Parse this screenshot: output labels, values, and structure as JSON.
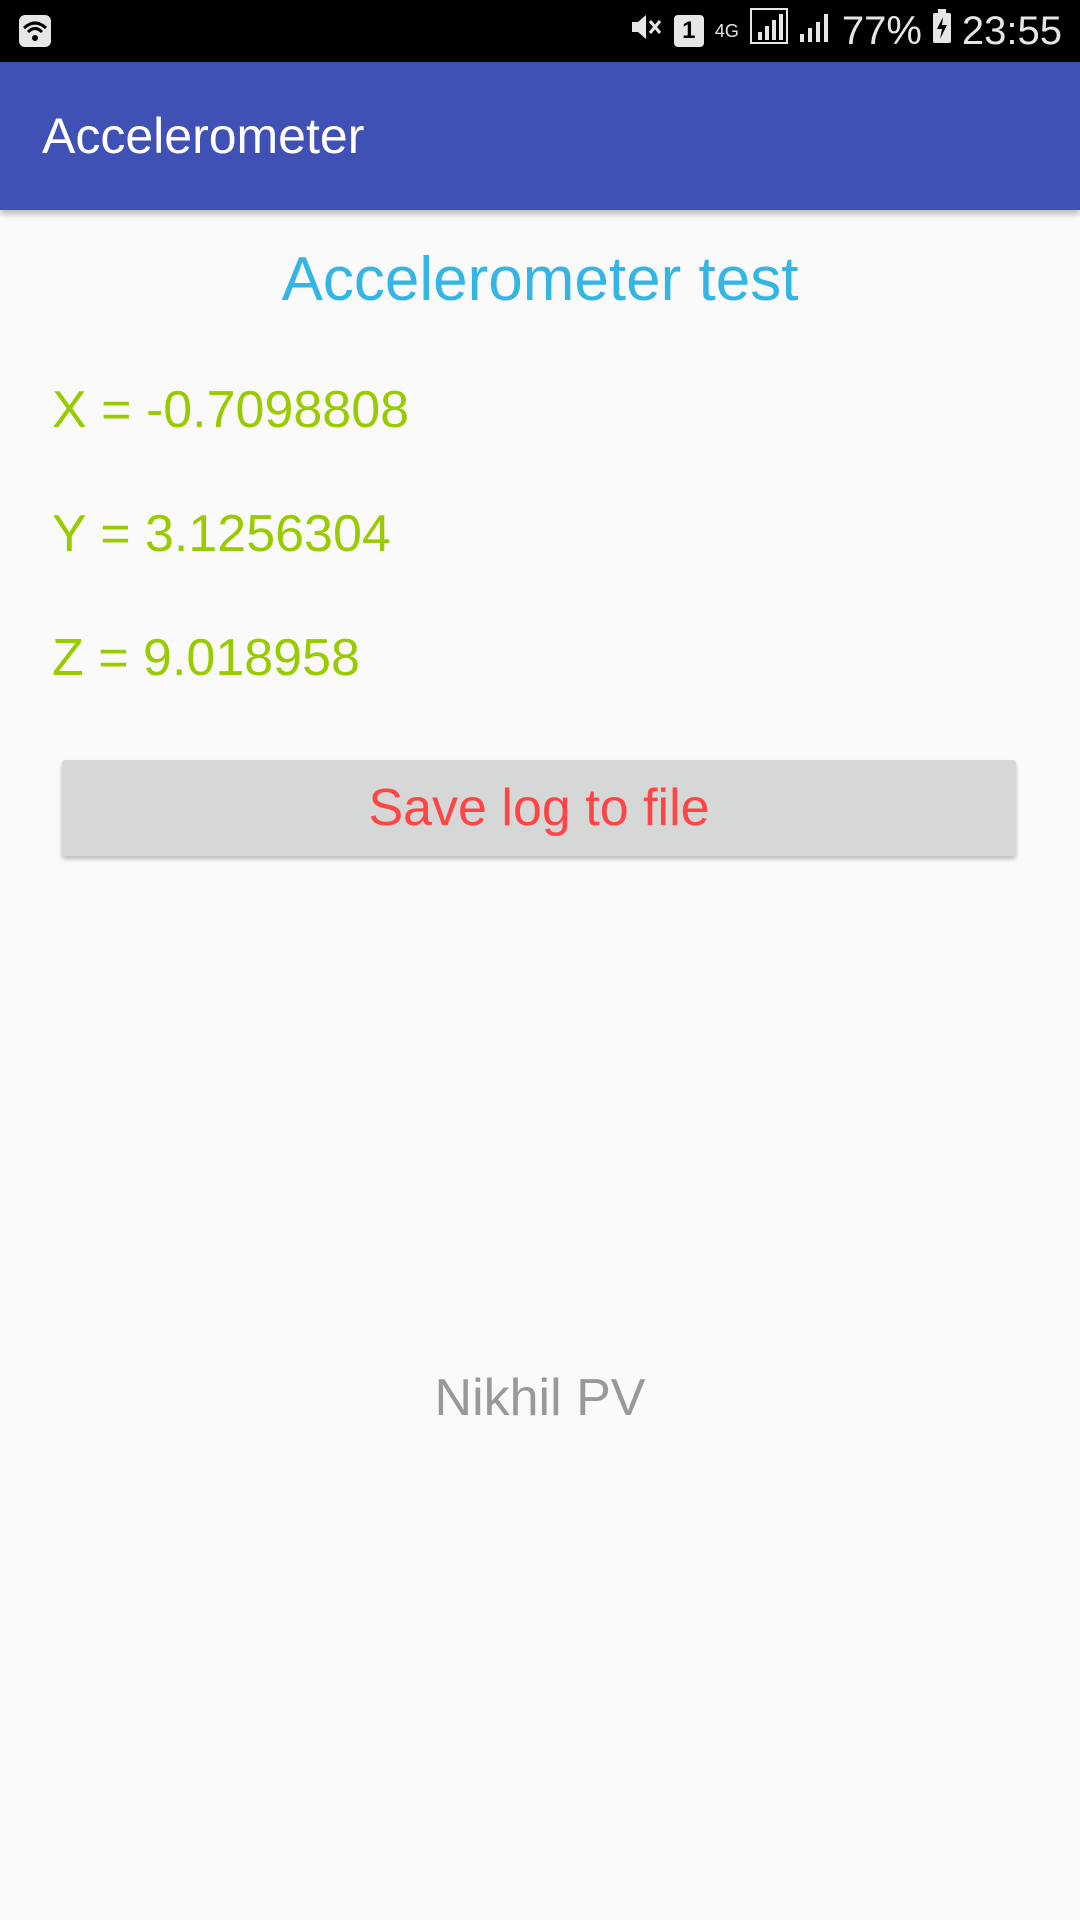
{
  "status_bar": {
    "sim_slot": "1",
    "network_type": "4G",
    "battery_percent": "77%",
    "time": "23:55",
    "icons": [
      "wifi-icon",
      "mute-icon",
      "sim-icon",
      "network-4g-icon",
      "signal-icon",
      "signal-icon",
      "battery-charging-icon"
    ]
  },
  "app_bar": {
    "title": "Accelerometer"
  },
  "main": {
    "heading": "Accelerometer test",
    "x_reading": "X = -0.7098808",
    "y_reading": "Y = 3.1256304",
    "z_reading": "Z = 9.018958",
    "save_button_label": "Save log to file",
    "author": "Nikhil PV"
  },
  "colors": {
    "app_bar": "#3f51b5",
    "heading": "#33b5e5",
    "readings": "#99cc00",
    "button_text": "#ff4444",
    "button_bg": "#d6d7d7",
    "author": "#999999"
  }
}
